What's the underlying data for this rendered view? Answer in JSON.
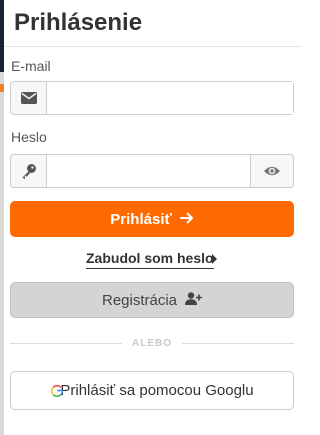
{
  "header": {
    "title": "Prihlásenie"
  },
  "form": {
    "email": {
      "label": "E-mail",
      "value": "",
      "placeholder": "",
      "icon": "envelope-icon"
    },
    "password": {
      "label": "Heslo",
      "value": "",
      "placeholder": "",
      "icon": "key-icon",
      "toggle_icon": "eye-icon"
    },
    "login_label": "Prihlásiť",
    "forgot_label": "Zabudol som heslo",
    "register_label": "Registrácia",
    "divider_label": "ALEBO",
    "google_label": "Prihlásiť sa pomocou Googlu"
  },
  "colors": {
    "accent": "#ff6a00",
    "register_bg": "#d4d4d4",
    "text": "#333333"
  }
}
